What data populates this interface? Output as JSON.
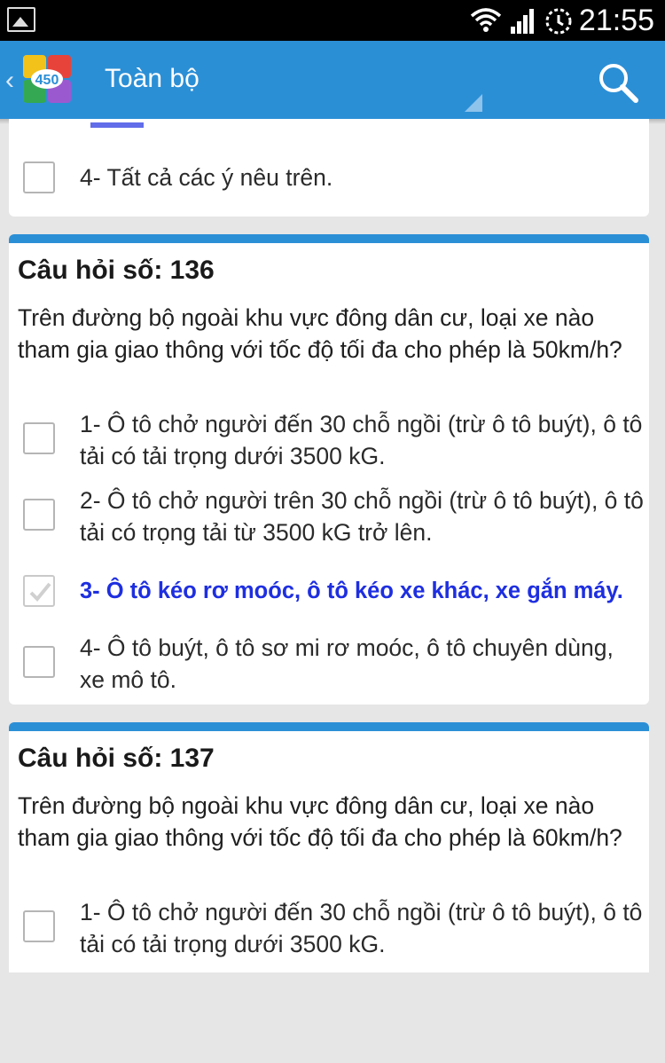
{
  "status_bar": {
    "time": "21:55",
    "icons": [
      "image-icon",
      "wifi-icon",
      "signal-icon",
      "alarm-icon"
    ]
  },
  "action_bar": {
    "title": "Toàn bộ",
    "logo_text": "450",
    "icons": [
      "back-chevron-icon",
      "search-icon"
    ]
  },
  "colors": {
    "accent": "#2b8fd6",
    "selected_answer": "#1e2fe0",
    "background": "#e6e6e6"
  },
  "prev_card": {
    "option": {
      "text": "4- Tất cả các ý nêu trên.",
      "checked": false
    }
  },
  "question_136": {
    "title": "Câu hỏi số: 136",
    "text": "Trên đường bộ ngoài khu vực đông dân cư, loại xe nào tham gia giao thông với tốc độ tối đa cho phép là 50km/h?",
    "options": [
      {
        "text": "1- Ô tô chở người đến 30 chỗ ngồi (trừ ô tô buýt), ô tô tải có tải trọng dưới 3500 kG.",
        "checked": false
      },
      {
        "text": "2- Ô tô chở người trên 30 chỗ ngồi (trừ ô tô buýt), ô tô tải có trọng tải từ 3500 kG trở lên.",
        "checked": false
      },
      {
        "text": "3- Ô tô kéo rơ moóc, ô tô kéo xe khác, xe gắn máy.",
        "checked": true
      },
      {
        "text": "4- Ô tô buýt, ô tô sơ mi rơ moóc, ô tô chuyên dùng, xe mô tô.",
        "checked": false
      }
    ]
  },
  "question_137": {
    "title": "Câu hỏi số: 137",
    "text": "Trên đường bộ ngoài khu vực đông dân cư, loại xe nào tham gia giao thông với tốc độ tối đa cho phép là 60km/h?",
    "options": [
      {
        "text": "1- Ô tô chở người đến 30 chỗ ngồi (trừ ô tô buýt), ô tô tải có tải trọng dưới 3500 kG.",
        "checked": false
      }
    ]
  }
}
